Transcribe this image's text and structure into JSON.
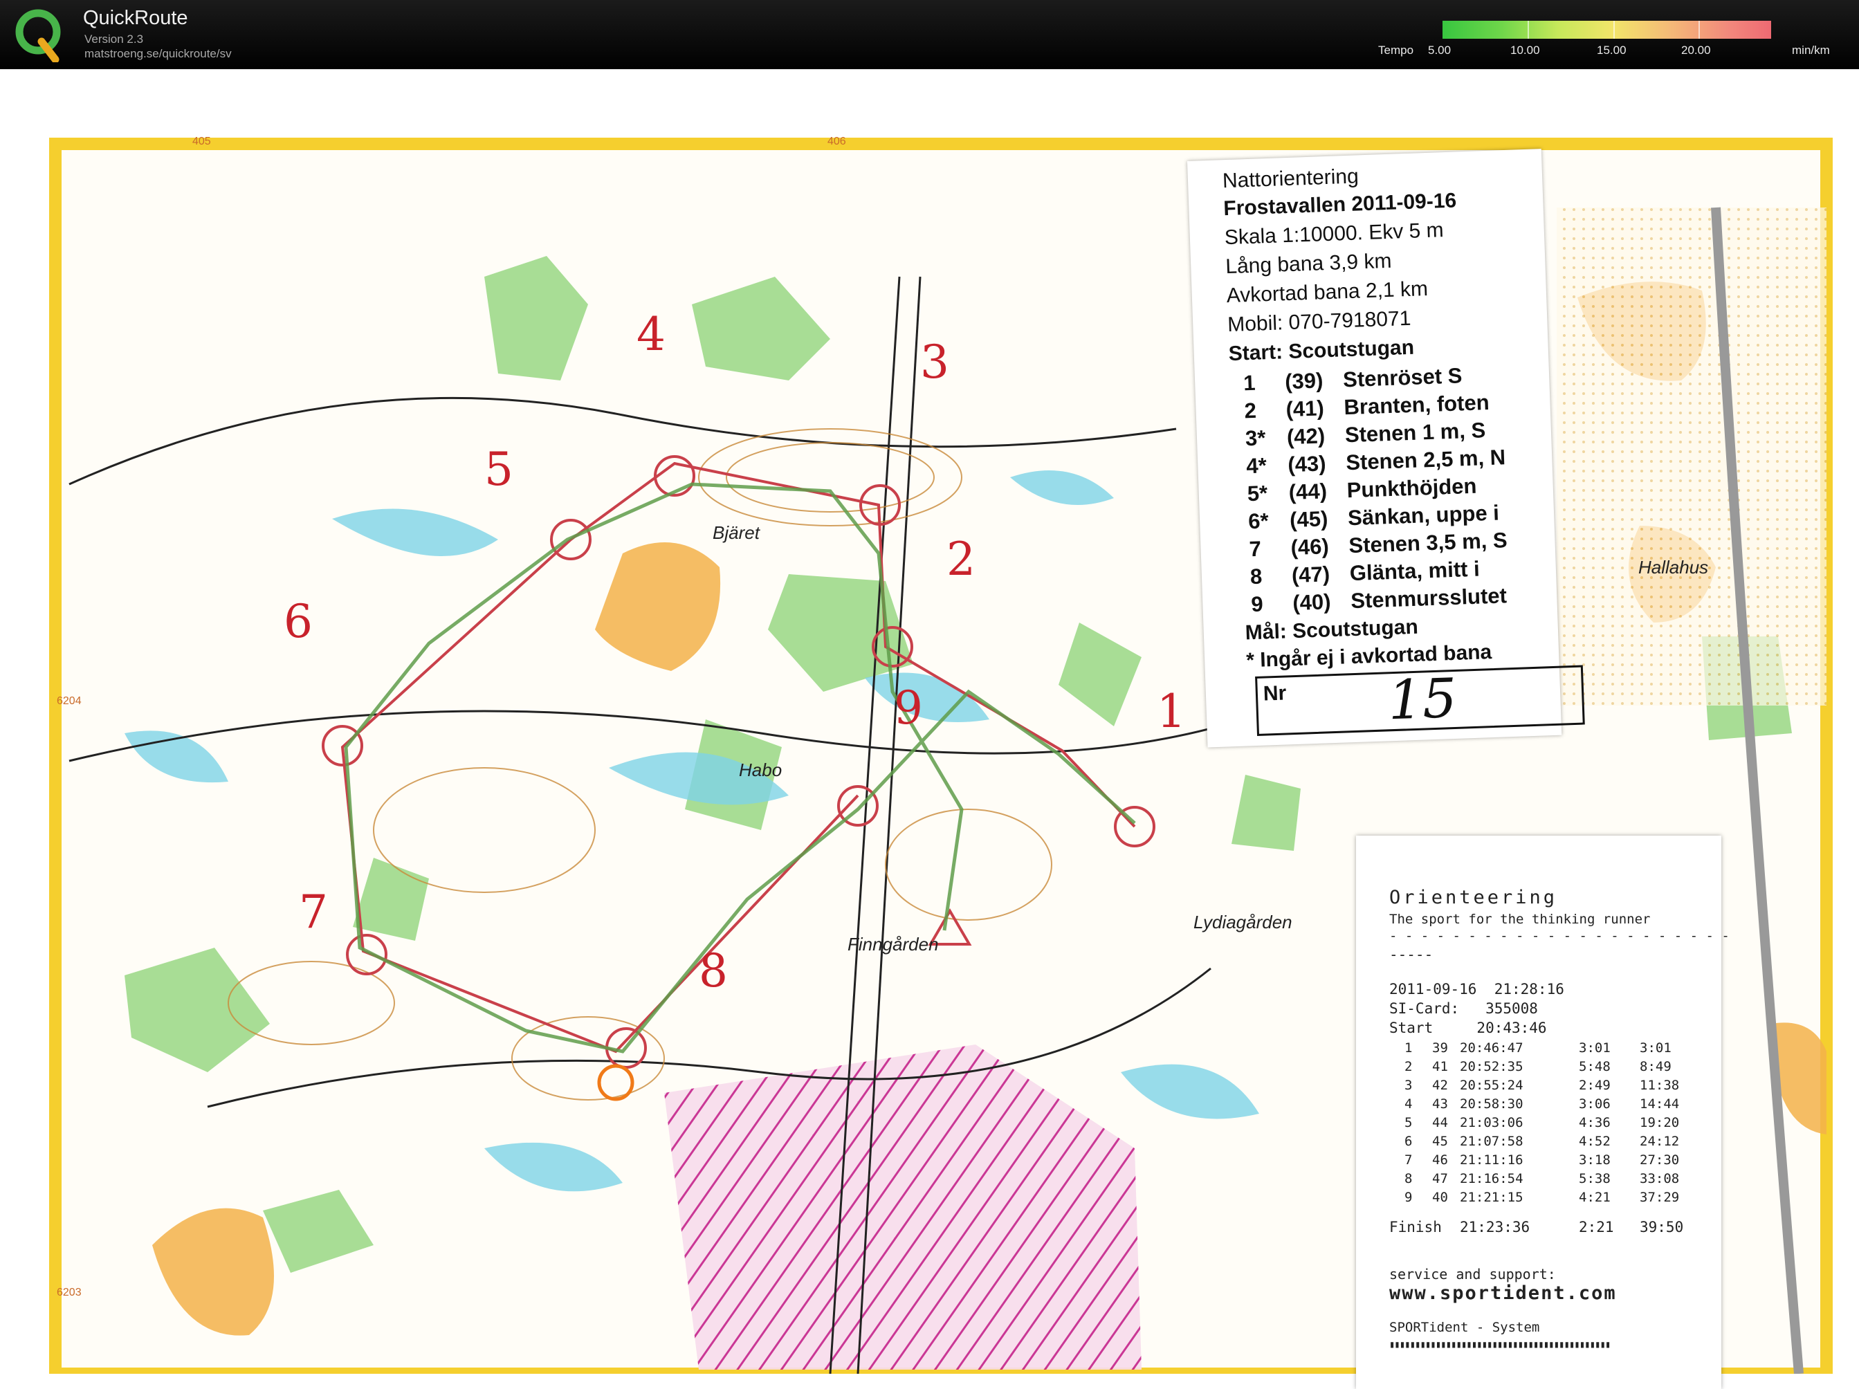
{
  "app": {
    "name": "QuickRoute",
    "version": "Version 2.3",
    "url": "matstroeng.se/quickroute/sv"
  },
  "tempo": {
    "label": "Tempo",
    "ticks": [
      "5.00",
      "10.00",
      "15.00",
      "20.00"
    ],
    "unit": "min/km",
    "colors": [
      "#38c640",
      "#c6e85a",
      "#f2e56a",
      "#f4b878",
      "#ee6a72"
    ]
  },
  "legend": {
    "title": "Nattorientering",
    "event": "Frostavallen 2011-09-16",
    "scale": "Skala 1:10000. Ekv 5 m",
    "long": "Lång bana 3,9 km",
    "short": "Avkortad bana 2,1 km",
    "mobile": "Mobil: 070-7918071",
    "start": "Start: Scoutstugan",
    "controls": [
      {
        "n": "1",
        "code": "(39)",
        "desc": "Stenröset S"
      },
      {
        "n": "2",
        "code": "(41)",
        "desc": "Branten, foten"
      },
      {
        "n": "3*",
        "code": "(42)",
        "desc": "Stenen 1 m, S"
      },
      {
        "n": "4*",
        "code": "(43)",
        "desc": "Stenen 2,5 m, N"
      },
      {
        "n": "5*",
        "code": "(44)",
        "desc": "Punkthöjden"
      },
      {
        "n": "6*",
        "code": "(45)",
        "desc": "Sänkan, uppe i"
      },
      {
        "n": "7",
        "code": "(46)",
        "desc": "Stenen 3,5 m, S"
      },
      {
        "n": "8",
        "code": "(47)",
        "desc": "Glänta, mitt i"
      },
      {
        "n": "9",
        "code": "(40)",
        "desc": "Stenmursslutet"
      }
    ],
    "finish": "Mål: Scoutstugan",
    "note": "* Ingår ej i avkortad bana",
    "nr_label": "Nr",
    "nr_value": "15"
  },
  "receipt": {
    "title": "Orienteering",
    "tagline": "The sport for the thinking runner",
    "dashes": "-----",
    "datetime": "2011-09-16  21:28:16",
    "sicard": "SI-Card:   355008",
    "start": "Start     20:43:46",
    "splits": [
      [
        "1",
        "39",
        "20:46:47",
        "3:01",
        "3:01"
      ],
      [
        "2",
        "41",
        "20:52:35",
        "5:48",
        "8:49"
      ],
      [
        "3",
        "42",
        "20:55:24",
        "2:49",
        "11:38"
      ],
      [
        "4",
        "43",
        "20:58:30",
        "3:06",
        "14:44"
      ],
      [
        "5",
        "44",
        "21:03:06",
        "4:36",
        "19:20"
      ],
      [
        "6",
        "45",
        "21:07:58",
        "4:52",
        "24:12"
      ],
      [
        "7",
        "46",
        "21:11:16",
        "3:18",
        "27:30"
      ],
      [
        "8",
        "47",
        "21:16:54",
        "5:38",
        "33:08"
      ],
      [
        "9",
        "40",
        "21:21:15",
        "4:21",
        "37:29"
      ]
    ],
    "finish": [
      "Finish",
      "21:23:36",
      "2:21",
      "39:50"
    ],
    "support": "service and support:",
    "web": "www.sportident.com",
    "system": "SPORTident - System"
  },
  "map": {
    "place_names": [
      "Bjäret",
      "Habo",
      "Finngården",
      "Lydiagården",
      "Hallahus"
    ],
    "grid_labels": [
      "405",
      "406",
      "6204",
      "6203"
    ],
    "control_numbers": [
      "1",
      "2",
      "3",
      "4",
      "5",
      "6",
      "7",
      "8",
      "9"
    ]
  }
}
